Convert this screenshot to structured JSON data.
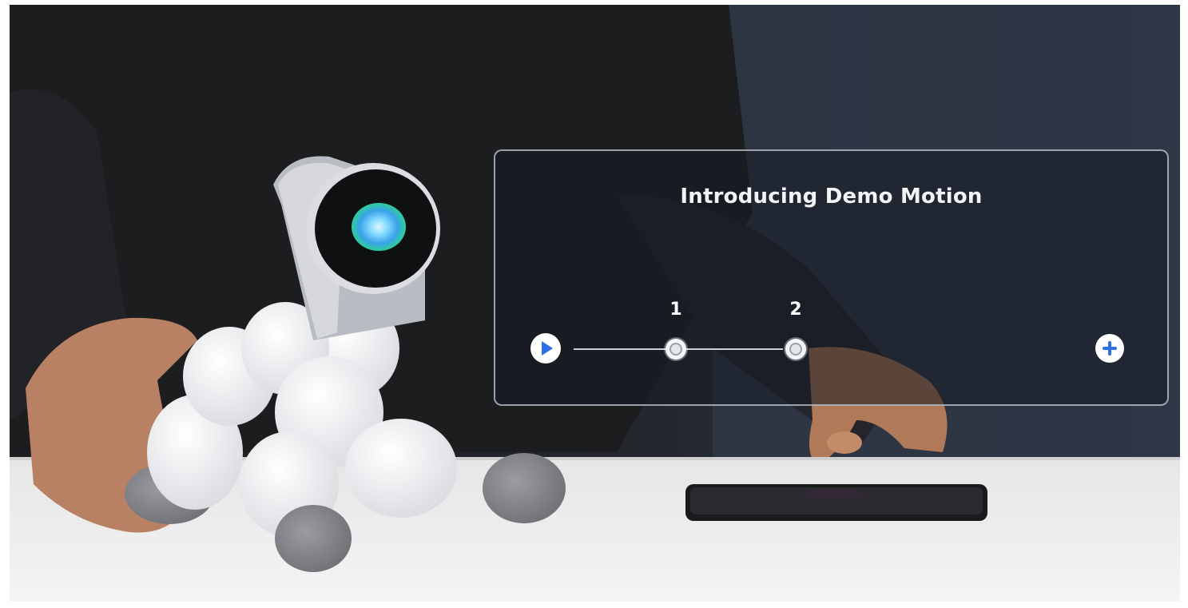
{
  "panel": {
    "title": "Introducing Demo Motion"
  },
  "timeline": {
    "keyframes": [
      {
        "label": "1"
      },
      {
        "label": "2"
      }
    ],
    "play_icon": "play-icon",
    "add_icon": "plus-icon"
  },
  "colors": {
    "accent": "#2f6fe4",
    "panel_border": "#c8ceda",
    "title_text": "#f2f4f8"
  }
}
